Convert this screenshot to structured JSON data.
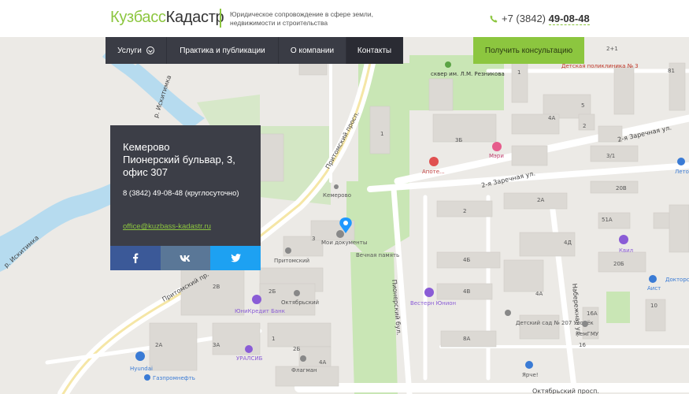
{
  "header": {
    "logo_part1": "Кузбасс",
    "logo_part2": "Кадастр",
    "tagline": "Юридическое сопровождение в сфере земли, недвижимости и строительства",
    "phone_prefix": "+7 (3842)",
    "phone_number": "49-08-48"
  },
  "nav": {
    "items": [
      {
        "label": "Услуги"
      },
      {
        "label": "Практика и публикации"
      },
      {
        "label": "О компании"
      },
      {
        "label": "Контакты"
      }
    ],
    "cta_label": "Получить консультацию"
  },
  "card": {
    "city": "Кемерово",
    "address": "Пионерский бульвар, 3, офис 307",
    "phone": "8 (3842) 49-08-48 (круглосуточно)",
    "email": "office@kuzbass-kadastr.ru"
  },
  "socials": [
    {
      "network": "facebook-icon"
    },
    {
      "network": "vk-icon"
    },
    {
      "network": "twitter-icon"
    }
  ],
  "map": {
    "labels": {
      "square": "сквер им. Л.М. Резникова",
      "polyclinic": "Детская поликлиника № 3",
      "pritomsky1": "Притомский просп.",
      "pritomsky2": "Притомский пр.",
      "zarechnaya1": "2-я Заречная ул.",
      "zarechnaya2": "2-я Заречная ул.",
      "pioner": "Пионерский бул.",
      "naberezhnaya": "Набережная ул.",
      "oktyabrsky": "Октябрьский просп.",
      "iskitimka": "р. Искитимка",
      "iskitimka2": "р. Искитимка",
      "kemerovo_stop": "Кемерово",
      "my_docs": "Мои документы",
      "vechnaya": "Вечная память",
      "pritomsky_poi": "Притомский",
      "oktyabrsky_poi": "Октябрьский",
      "unicredit": "ЮниКредит Банк",
      "uralsib": "УРАЛСИБ",
      "flagman": "Флагман",
      "hyundai": "Hyundai",
      "gazprom": "Газпромнефть",
      "western": "Вестерн Юнион",
      "kindergarten": "Детский сад № 207 Уголёк",
      "kemgmu": "КемГМУ",
      "yarche": "Ярче!",
      "aptekar": "Аптекарь",
      "meri": "Мэри",
      "aptek2": "Апоте...",
      "kvil": "Квил",
      "doctor": "Докторская",
      "aist": "Аист",
      "leto": "Лето"
    },
    "house_numbers": [
      "1",
      "3",
      "3Б",
      "4А",
      "2А",
      "20В",
      "51А",
      "20Б",
      "2",
      "4Б",
      "4В",
      "2Б",
      "2В",
      "2А",
      "8А",
      "4А",
      "16А",
      "4Д",
      "10",
      "5",
      "3/1",
      "2",
      "1",
      "2Б",
      "3А",
      "1",
      "16",
      "4А",
      "2+1",
      "81"
    ]
  },
  "colors": {
    "accent": "#8cc63f",
    "nav_bg": "#3a3c45",
    "nav_active": "#2a2b33",
    "card_bg": "#3c3e47",
    "facebook": "#3b5998",
    "vk": "#5a7797",
    "twitter": "#1da1f2",
    "map_bg": "#e9e7e3",
    "park": "#c6e5b4",
    "water": "#b4dcf0"
  }
}
